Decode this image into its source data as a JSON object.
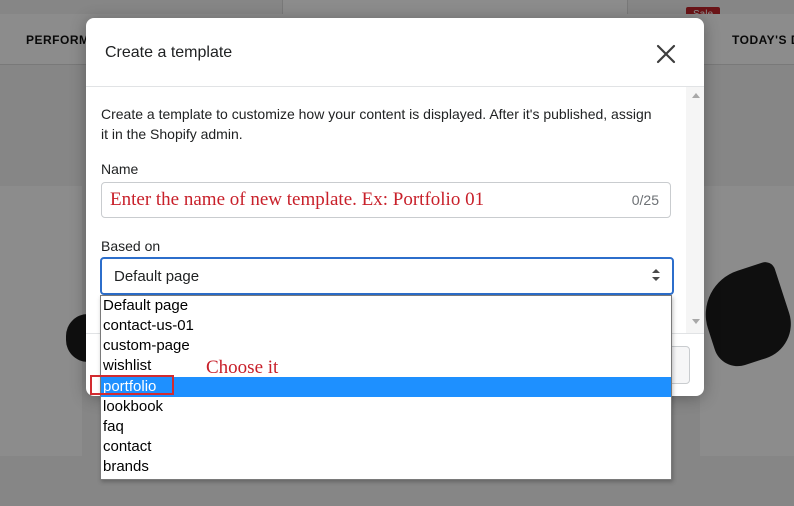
{
  "background": {
    "nav_left": "PERFORM",
    "nav_right": "TODAY'S D",
    "sale_badge": "Sale"
  },
  "modal": {
    "title": "Create a template",
    "description": "Create a template to customize how your content is displayed. After it's published, assign it in the Shopify admin.",
    "name_label": "Name",
    "name_input": {
      "value": "Enter the name of new template. Ex: Portfolio 01",
      "counter": "0/25"
    },
    "based_on_label": "Based on",
    "based_on_select": {
      "value": "Default page"
    }
  },
  "dropdown": {
    "options": [
      "Default page",
      "contact-us-01",
      "custom-page",
      "wishlist",
      "portfolio",
      "lookbook",
      "faq",
      "contact",
      "brands"
    ],
    "selected_index": 4,
    "highlight_color": "#1e90ff"
  },
  "annotation": {
    "choose_note": "Choose it",
    "note_color": "#c8202a"
  }
}
